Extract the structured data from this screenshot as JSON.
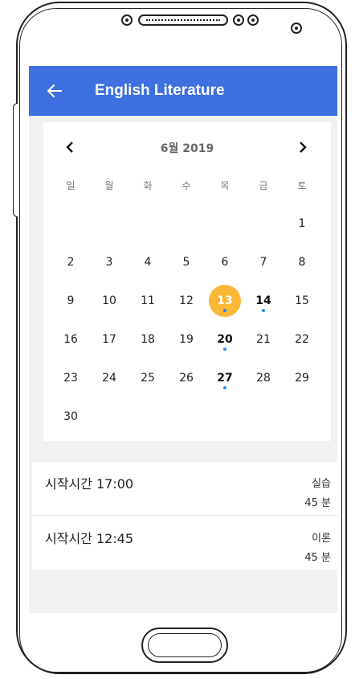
{
  "app_bar": {
    "title": "English Literature",
    "back_icon": "arrow-left-icon"
  },
  "calendar": {
    "month_label": "6월 2019",
    "prev_icon": "chevron-left-icon",
    "next_icon": "chevron-right-icon",
    "weekdays": [
      "일",
      "월",
      "화",
      "수",
      "목",
      "금",
      "토"
    ],
    "days": [
      "1",
      "2",
      "3",
      "4",
      "5",
      "6",
      "7",
      "8",
      "9",
      "10",
      "11",
      "12",
      "13",
      "14",
      "15",
      "16",
      "17",
      "18",
      "19",
      "20",
      "21",
      "22",
      "23",
      "24",
      "25",
      "26",
      "27",
      "28",
      "29",
      "30"
    ],
    "selected_day": "13",
    "event_days": [
      "13",
      "14",
      "20",
      "27"
    ],
    "accent_color": "#fbb837",
    "event_dot_color": "#2f86f0"
  },
  "sessions": [
    {
      "start": "시작시간 17:00",
      "type": "실습",
      "duration": "45 분"
    },
    {
      "start": "시작시간 12:45",
      "type": "이론",
      "duration": "45 분"
    }
  ],
  "colors": {
    "app_bar": "#3d70e0"
  }
}
